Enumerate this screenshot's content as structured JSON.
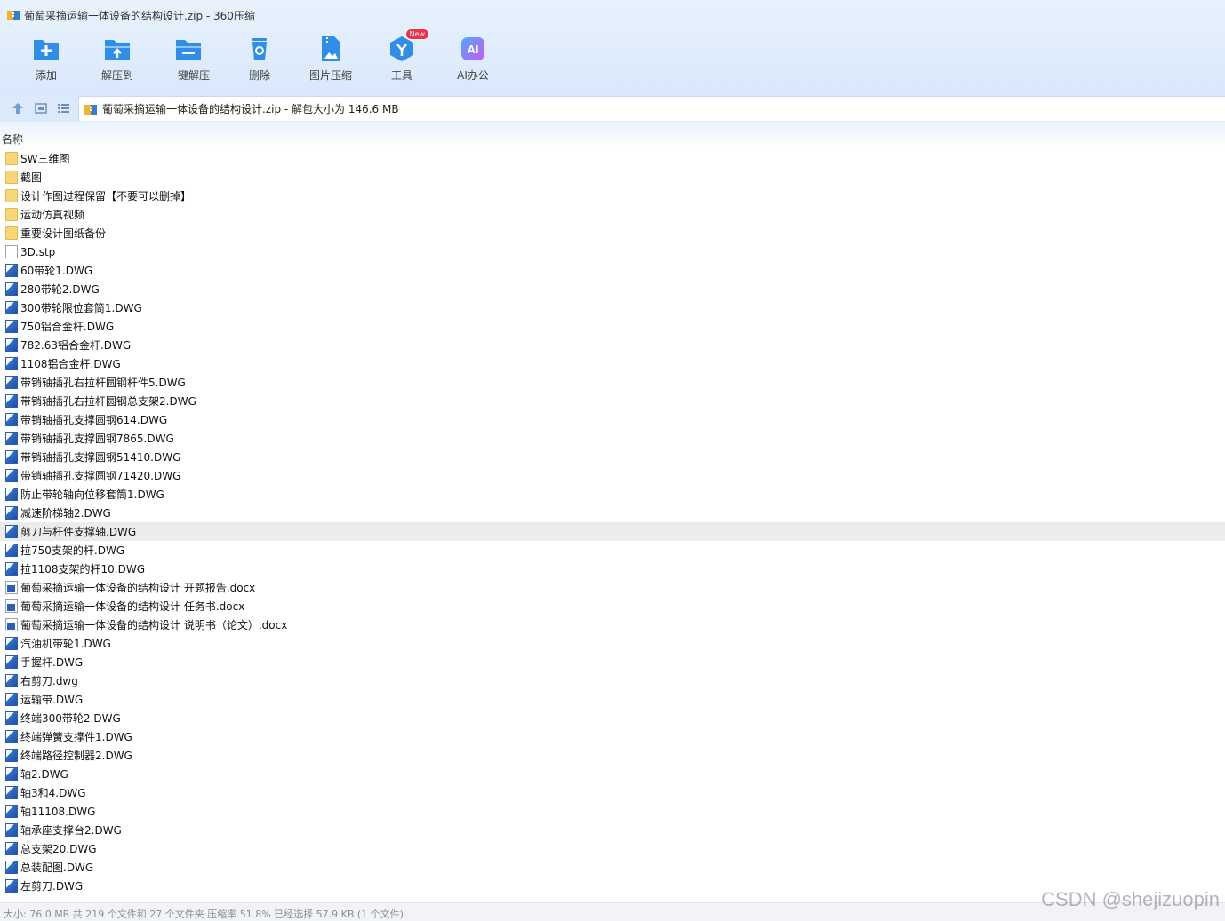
{
  "window": {
    "title": "葡萄采摘运输一体设备的结构设计.zip - 360压缩"
  },
  "toolbar": {
    "items": [
      {
        "label": "添加",
        "icon": "add-icon"
      },
      {
        "label": "解压到",
        "icon": "extract-to-icon"
      },
      {
        "label": "一键解压",
        "icon": "one-click-extract-icon"
      },
      {
        "label": "删除",
        "icon": "delete-icon"
      },
      {
        "label": "图片压缩",
        "icon": "image-compress-icon"
      },
      {
        "label": "工具",
        "icon": "tools-icon",
        "badge": "New"
      },
      {
        "label": "AI办公",
        "icon": "ai-office-icon"
      }
    ]
  },
  "address": {
    "text": "葡萄采摘运输一体设备的结构设计.zip - 解包大小为 146.6 MB"
  },
  "columns": {
    "name": "名称"
  },
  "files": [
    {
      "name": "SW三维图",
      "type": "folder"
    },
    {
      "name": "截图",
      "type": "folder"
    },
    {
      "name": "设计作图过程保留【不要可以删掉】",
      "type": "folder"
    },
    {
      "name": "运动仿真视频",
      "type": "folder"
    },
    {
      "name": "重要设计图纸备份",
      "type": "folder"
    },
    {
      "name": "3D.stp",
      "type": "file"
    },
    {
      "name": "60带轮1.DWG",
      "type": "dwg"
    },
    {
      "name": "280带轮2.DWG",
      "type": "dwg"
    },
    {
      "name": "300带轮限位套筒1.DWG",
      "type": "dwg"
    },
    {
      "name": "750铝合金杆.DWG",
      "type": "dwg"
    },
    {
      "name": "782.63铝合金杆.DWG",
      "type": "dwg"
    },
    {
      "name": "1108铝合金杆.DWG",
      "type": "dwg"
    },
    {
      "name": "带销轴插孔右拉杆圆钢杆件5.DWG",
      "type": "dwg"
    },
    {
      "name": "带销轴插孔右拉杆圆钢总支架2.DWG",
      "type": "dwg"
    },
    {
      "name": "带销轴插孔支撑圆钢614.DWG",
      "type": "dwg"
    },
    {
      "name": "带销轴插孔支撑圆钢7865.DWG",
      "type": "dwg"
    },
    {
      "name": "带销轴插孔支撑圆钢51410.DWG",
      "type": "dwg"
    },
    {
      "name": "带销轴插孔支撑圆钢71420.DWG",
      "type": "dwg"
    },
    {
      "name": "防止带轮轴向位移套筒1.DWG",
      "type": "dwg"
    },
    {
      "name": "减速阶梯轴2.DWG",
      "type": "dwg"
    },
    {
      "name": "剪刀与杆件支撑轴.DWG",
      "type": "dwg",
      "selected": true
    },
    {
      "name": "拉750支架的杆.DWG",
      "type": "dwg"
    },
    {
      "name": "拉1108支架的杆10.DWG",
      "type": "dwg"
    },
    {
      "name": "葡萄采摘运输一体设备的结构设计 开题报告.docx",
      "type": "docx"
    },
    {
      "name": "葡萄采摘运输一体设备的结构设计 任务书.docx",
      "type": "docx"
    },
    {
      "name": "葡萄采摘运输一体设备的结构设计 说明书（论文）.docx",
      "type": "docx"
    },
    {
      "name": "汽油机带轮1.DWG",
      "type": "dwg"
    },
    {
      "name": "手握杆.DWG",
      "type": "dwg"
    },
    {
      "name": "右剪刀.dwg",
      "type": "dwg"
    },
    {
      "name": "运输带.DWG",
      "type": "dwg"
    },
    {
      "name": "终端300带轮2.DWG",
      "type": "dwg"
    },
    {
      "name": "终端弹簧支撑件1.DWG",
      "type": "dwg"
    },
    {
      "name": "终端路径控制器2.DWG",
      "type": "dwg"
    },
    {
      "name": "轴2.DWG",
      "type": "dwg"
    },
    {
      "name": "轴3和4.DWG",
      "type": "dwg"
    },
    {
      "name": "轴11108.DWG",
      "type": "dwg"
    },
    {
      "name": "轴承座支撑台2.DWG",
      "type": "dwg"
    },
    {
      "name": "总支架20.DWG",
      "type": "dwg"
    },
    {
      "name": "总装配图.DWG",
      "type": "dwg"
    },
    {
      "name": "左剪刀.DWG",
      "type": "dwg"
    }
  ],
  "status": {
    "text": "大小: 76.0 MB 共 219 个文件和 27 个文件夹 压缩率 51.8% 已经选择 57.9 KB (1 个文件)"
  },
  "watermark": {
    "text": "CSDN @shejizuopin"
  },
  "colors": {
    "toolbar_bg": "#e9f2fd",
    "icon_blue": "#2f8ee8",
    "selected_row": "#ececec",
    "badge_red": "#f2304b"
  }
}
